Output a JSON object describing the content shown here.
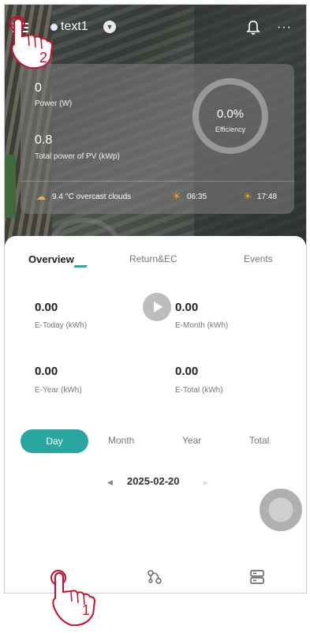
{
  "header": {
    "plant_name": "text1",
    "dropdown_glyph": "▼",
    "icons": [
      "menu-icon",
      "bell-icon",
      "more-icon"
    ],
    "more_glyph": "···"
  },
  "stats": {
    "power_value": "0",
    "power_label": "Power (W)",
    "pv_value": "0.8",
    "pv_label": "Total power of PV (kWp)",
    "efficiency_value": "0.0%",
    "efficiency_label": "Efficiency",
    "weather": "9.4 °C overcast clouds",
    "sunrise": "06:35",
    "sunset": "17:48"
  },
  "tabs": {
    "overview": "Overview",
    "return_ec": "Return&EC",
    "events": "Events"
  },
  "metrics": [
    {
      "value": "0.00",
      "label": "E-Today (kWh)"
    },
    {
      "value": "0.00",
      "label": "E-Month (kWh)"
    },
    {
      "value": "0.00",
      "label": "E-Year (kWh)"
    },
    {
      "value": "0.00",
      "label": "E-Total (kWh)"
    }
  ],
  "periods": {
    "day": "Day",
    "month": "Month",
    "year": "Year",
    "total": "Total"
  },
  "date": {
    "value": "2025-02-20",
    "prev_glyph": "◀",
    "next_glyph": "▶"
  },
  "annotations": {
    "marker_1": "1",
    "marker_2": "2"
  },
  "colors": {
    "accent": "#2aa6a0",
    "marker": "#c8102e"
  }
}
